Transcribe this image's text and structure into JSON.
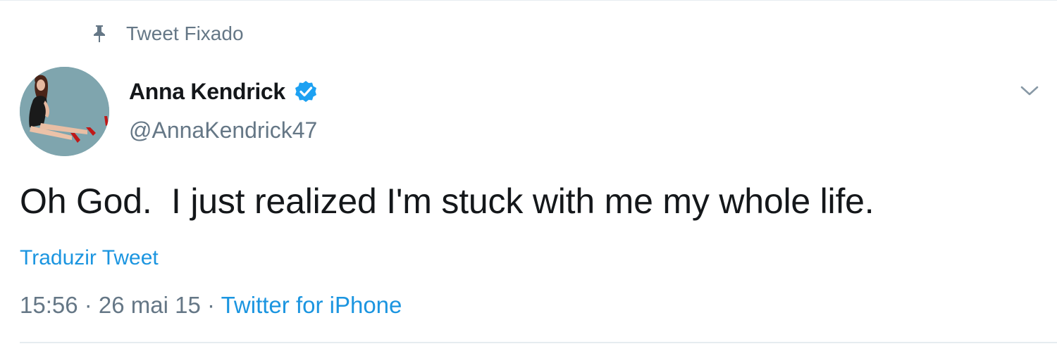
{
  "pinned": {
    "icon": "pin-icon",
    "label": "Tweet Fixado"
  },
  "author": {
    "avatar_icon": "avatar",
    "display_name": "Anna Kendrick",
    "verified_icon": "verified-badge-icon",
    "handle": "@AnnaKendrick47"
  },
  "menu": {
    "icon": "chevron-down-icon"
  },
  "tweet": {
    "text": "Oh God.  I just realized I'm stuck with me my whole life.",
    "translate_label": "Traduzir Tweet",
    "time": "15:56",
    "separator1": " · ",
    "date": "26 mai 15",
    "separator2": " · ",
    "source": "Twitter for iPhone"
  },
  "colors": {
    "link": "#1b95e0",
    "secondary_text": "#657786",
    "primary_text": "#14171a",
    "verified": "#1da1f2"
  }
}
